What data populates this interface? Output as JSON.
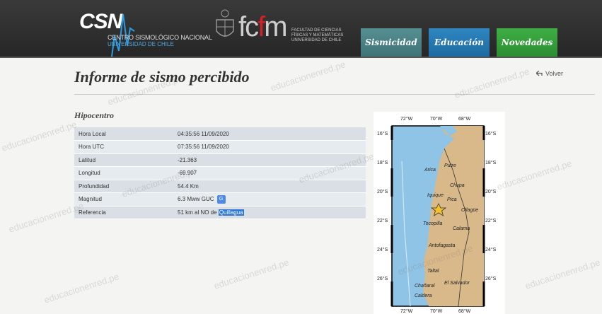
{
  "header": {
    "logo_text": "CSN",
    "logo_sub1": "CENTRO SISMOLÓGICO NACIONAL",
    "logo_sub2": "UNIVERSIDAD DE CHILE",
    "fcfm_a": "fc",
    "fcfm_b": "f",
    "fcfm_c": "m",
    "fcfm_text": "FACULTAD DE CIENCIAS FÍSICAS Y MATEMÁTICAS UNIVERSIDAD DE CHILE",
    "nav": [
      "Sismicidad",
      "Educación",
      "Novedades"
    ]
  },
  "page": {
    "title": "Informe de sismo percibido",
    "back_label": "Volver",
    "section": "Hipocentro"
  },
  "hypocenter": [
    {
      "label": "Hora Local",
      "value": "04:35:56 11/09/2020"
    },
    {
      "label": "Hora UTC",
      "value": "07:35:56 11/09/2020"
    },
    {
      "label": "Latitud",
      "value": "-21.363"
    },
    {
      "label": "Longitud",
      "value": "-69.907"
    },
    {
      "label": "Profundidad",
      "value": "54.4 Km"
    },
    {
      "label": "Magnitud",
      "value": "6.3 Mww GUC"
    },
    {
      "label": "Referencia",
      "value_prefix": "51 km al NO de ",
      "value_link": "Quillagua"
    }
  ],
  "map": {
    "lon_labels": [
      "72°W",
      "70°W",
      "68°W"
    ],
    "lat_labels": [
      "16°S",
      "18°S",
      "20°S",
      "22°S",
      "24°S",
      "26°S"
    ],
    "places": [
      "Arica",
      "Putre",
      "Iquique",
      "Chupa",
      "Pica",
      "Ollagüe",
      "Tocopilla",
      "Calama",
      "Antofagasta",
      "Taltal",
      "Chañaral",
      "El Salvador",
      "Caldera"
    ],
    "ocean_color": "#8fc4e6",
    "land_color": "#d9b98a",
    "epicenter_color": "#f2c12e"
  },
  "watermark": "educacionenred.pe"
}
